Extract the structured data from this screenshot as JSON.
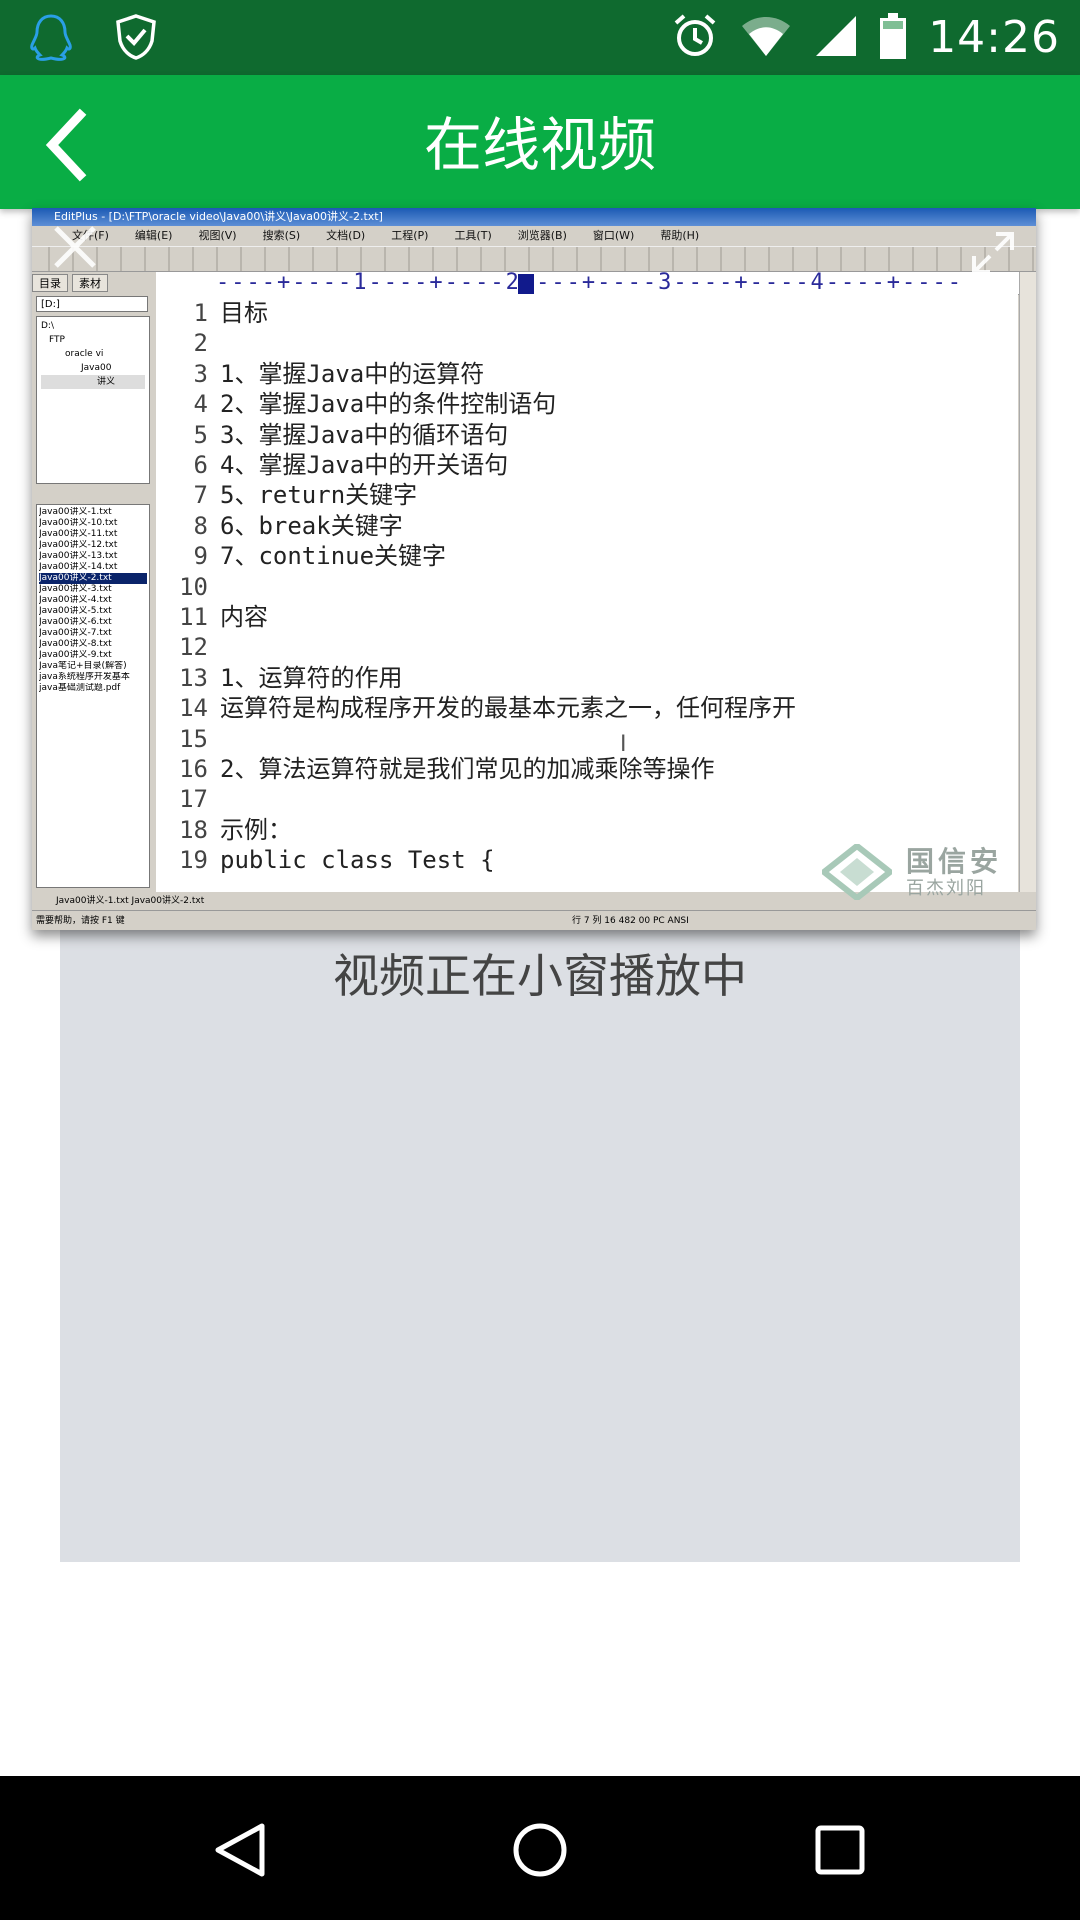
{
  "status_bar": {
    "time": "14:26",
    "icons": [
      "qq-icon",
      "shield-icon",
      "alarm-icon",
      "wifi-icon",
      "signal-icon",
      "battery-icon"
    ]
  },
  "app_bar": {
    "title": "在线视频",
    "back_icon": "chevron-left-icon"
  },
  "player": {
    "status_text": "视频正在小窗播放中"
  },
  "pip_video": {
    "editor_title": "EditPlus - [D:\\FTP\\oracle video\\Java00\\讲义\\Java00讲义-2.txt]",
    "menu": [
      "文件(F)",
      "编辑(E)",
      "视图(V)",
      "搜索(S)",
      "文档(D)",
      "工程(P)",
      "工具(T)",
      "浏览器(B)",
      "窗口(W)",
      "帮助(H)"
    ],
    "side_tabs": [
      "目录",
      "素材"
    ],
    "drive": "[D:]",
    "tree": [
      "D:\\",
      "FTP",
      "oracle vi",
      "Java00",
      "讲义"
    ],
    "files": [
      {
        "name": "Java00讲义-1.txt",
        "selected": false
      },
      {
        "name": "Java00讲义-10.txt",
        "selected": false
      },
      {
        "name": "Java00讲义-11.txt",
        "selected": false
      },
      {
        "name": "Java00讲义-12.txt",
        "selected": false
      },
      {
        "name": "Java00讲义-13.txt",
        "selected": false
      },
      {
        "name": "Java00讲义-14.txt",
        "selected": false
      },
      {
        "name": "Java00讲义-2.txt",
        "selected": true
      },
      {
        "name": "Java00讲义-3.txt",
        "selected": false
      },
      {
        "name": "Java00讲义-4.txt",
        "selected": false
      },
      {
        "name": "Java00讲义-5.txt",
        "selected": false
      },
      {
        "name": "Java00讲义-6.txt",
        "selected": false
      },
      {
        "name": "Java00讲义-7.txt",
        "selected": false
      },
      {
        "name": "Java00讲义-8.txt",
        "selected": false
      },
      {
        "name": "Java00讲义-9.txt",
        "selected": false
      },
      {
        "name": "Java笔记+目录(解答)",
        "selected": false
      },
      {
        "name": "java系统程序开发基本",
        "selected": false
      },
      {
        "name": "java基础测试题.pdf",
        "selected": false
      }
    ],
    "ruler": "----+----1----+----2----+----3----+----4----+----",
    "lines": [
      {
        "n": "1",
        "text": "目标"
      },
      {
        "n": "2",
        "text": ""
      },
      {
        "n": "3",
        "text": "1、掌握Java中的运算符"
      },
      {
        "n": "4",
        "text": "2、掌握Java中的条件控制语句"
      },
      {
        "n": "5",
        "text": "3、掌握Java中的循环语句"
      },
      {
        "n": "6",
        "text": "4、掌握Java中的开关语句"
      },
      {
        "n": "7",
        "text": "5、return关键字"
      },
      {
        "n": "8",
        "text": "6、break关键字"
      },
      {
        "n": "9",
        "text": "7、continue关键字"
      },
      {
        "n": "10",
        "text": ""
      },
      {
        "n": "11",
        "text": "内容"
      },
      {
        "n": "12",
        "text": ""
      },
      {
        "n": "13",
        "text": "1、运算符的作用"
      },
      {
        "n": "14",
        "text": "运算符是构成程序开发的最基本元素之一，任何程序开"
      },
      {
        "n": "15",
        "text": ""
      },
      {
        "n": "16",
        "text": "2、算法运算符就是我们常见的加减乘除等操作"
      },
      {
        "n": "17",
        "text": ""
      },
      {
        "n": "18",
        "text": "示例："
      },
      {
        "n": "19",
        "text": "public class Test {"
      }
    ],
    "doc_tabs": "Java00讲义-1.txt   Java00讲义-2.txt",
    "status": "需要帮助，请按 F1 键",
    "status_right": "行 7    列 16    482    00    PC    ANSI",
    "watermark_title": "国信安",
    "watermark_sub": "百杰刘阳"
  },
  "navigation": {
    "back": "back-triangle-icon",
    "home": "home-circle-icon",
    "recents": "recents-square-icon"
  },
  "colors": {
    "status_bar": "#0f6a2f",
    "app_bar": "#09ad45",
    "placeholder": "#dcdfe4",
    "nav_bar": "#000000"
  }
}
